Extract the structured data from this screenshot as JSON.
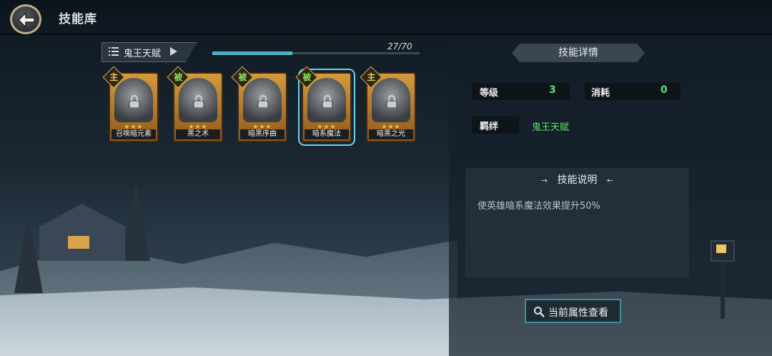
{
  "header": {
    "title": "技能库"
  },
  "talent": {
    "name": "鬼王天赋",
    "progress_text": "27/70",
    "progress_fraction": 0.386
  },
  "skills": [
    {
      "type": "主",
      "name": "召唤暗元素",
      "stars": "★★★",
      "kind": "main"
    },
    {
      "type": "被",
      "name": "黑之术",
      "stars": "★★★",
      "kind": "passive"
    },
    {
      "type": "被",
      "name": "暗黑序曲",
      "stars": "★★★",
      "kind": "passive"
    },
    {
      "type": "被",
      "name": "暗系魔法",
      "stars": "★★★",
      "kind": "passive",
      "selected": true
    },
    {
      "type": "主",
      "name": "暗黑之光",
      "stars": "★★★",
      "kind": "main"
    }
  ],
  "detail": {
    "title": "技能详情",
    "level_label": "等级",
    "level_value": "3",
    "cost_label": "消耗",
    "cost_value": "0",
    "bond_label": "羁绊",
    "bond_value": "鬼王天赋",
    "desc_title": "技能说明",
    "desc_text": "使英雄暗系魔法效果提升50%"
  },
  "buttons": {
    "view_attributes": "当前属性查看"
  },
  "colors": {
    "accent": "#4fb2c4",
    "value_green": "#62e06a",
    "card_gold": "#d49a3b"
  }
}
